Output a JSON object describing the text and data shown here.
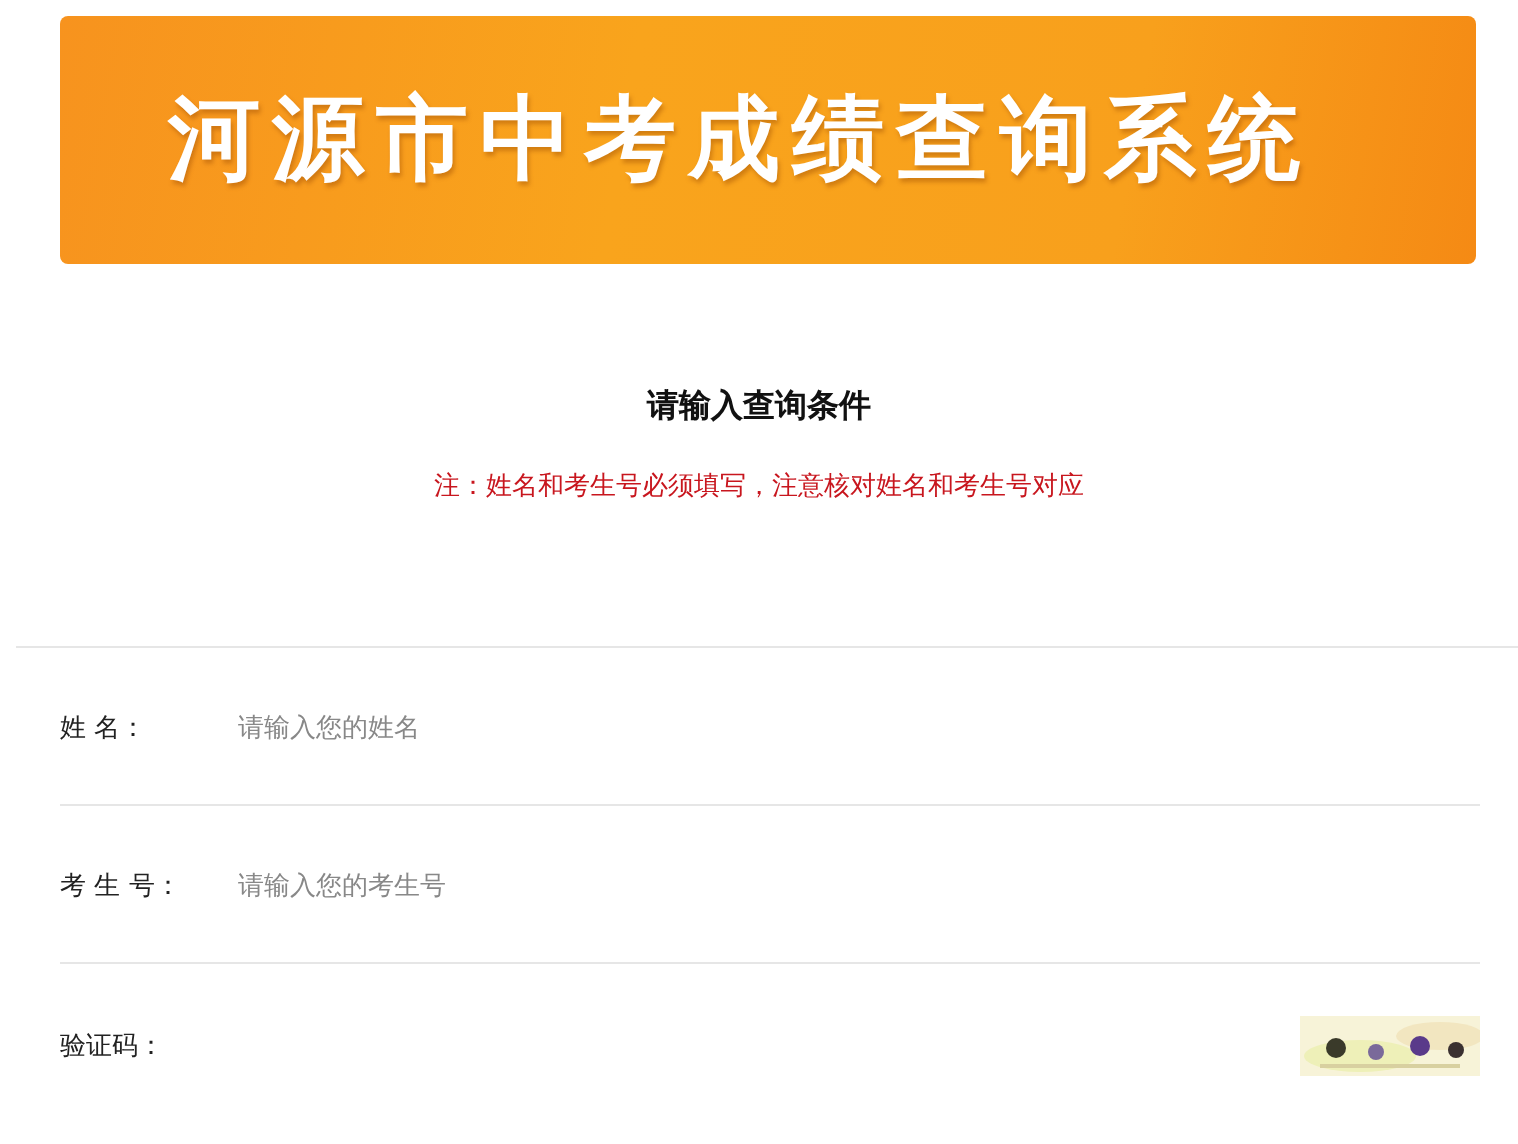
{
  "banner": {
    "title": "河源市中考成绩查询系统"
  },
  "heading": "请输入查询条件",
  "note": "注：姓名和考生号必须填写，注意核对姓名和考生号对应",
  "fields": [
    {
      "kind": "text",
      "label": "姓 名：",
      "placeholder": "请输入您的姓名"
    },
    {
      "kind": "text",
      "label": "考 生 号：",
      "placeholder": "请输入您的考生号"
    },
    {
      "kind": "captcha",
      "label": "验证码："
    }
  ]
}
